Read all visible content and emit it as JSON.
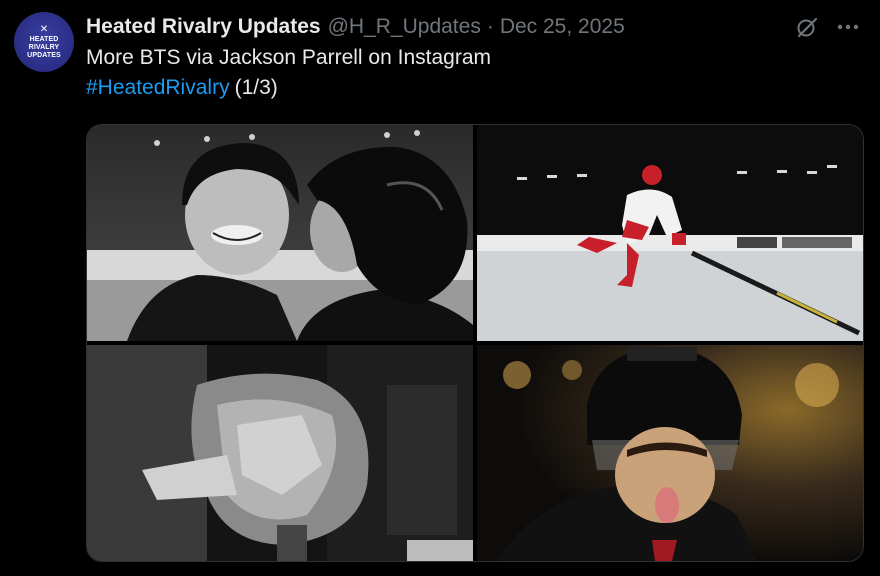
{
  "account": {
    "avatar_lines": [
      "HEATED",
      "RIVALRY",
      "UPDATES"
    ],
    "name": "Heated Rivalry Updates",
    "handle": "@H_R_Updates",
    "separator": "·",
    "date": "Dec 25, 2025"
  },
  "icons": {
    "grok": "grok-icon",
    "more": "more-icon"
  },
  "tweet": {
    "line1": "More BTS via Jackson Parrell on Instagram",
    "hashtag": "#HeatedRivalry",
    "suffix": "(1/3)"
  },
  "media": {
    "photos": [
      {
        "subject": "two hockey players in CCM helmets, one kissing the other's cheek, black and white"
      },
      {
        "subject": "hockey player in red and white jersey skating on ice rink"
      },
      {
        "subject": "camera wrapped in plastic, black and white"
      },
      {
        "subject": "close-up of hockey player in CCM helmet with visor sticking tongue out"
      }
    ],
    "colors": {
      "link": "#1d9bf0",
      "muted": "#71767b",
      "text": "#e7e9ea",
      "avatar_bg": "#2a2e86"
    }
  }
}
